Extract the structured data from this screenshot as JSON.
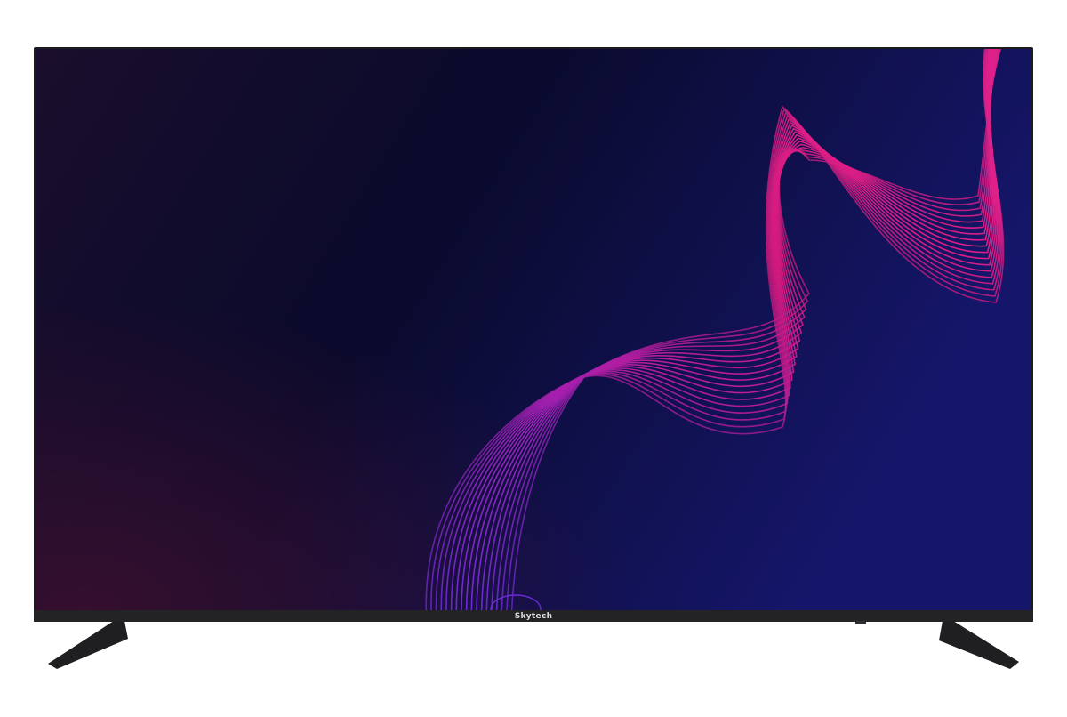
{
  "product": {
    "brand": "Skytech"
  },
  "colors": {
    "bezel": "#1b1b1d",
    "screen_top_left": "#170d2c",
    "screen_center": "#0a0a2e",
    "screen_right": "#13145c",
    "screen_bottom_left": "#2a0d2a",
    "wave_pink": "#d4197e",
    "wave_purple": "#6b2bd6",
    "stand": "#222226",
    "brand_text": "#dcdcdc",
    "background": "#ffffff"
  }
}
